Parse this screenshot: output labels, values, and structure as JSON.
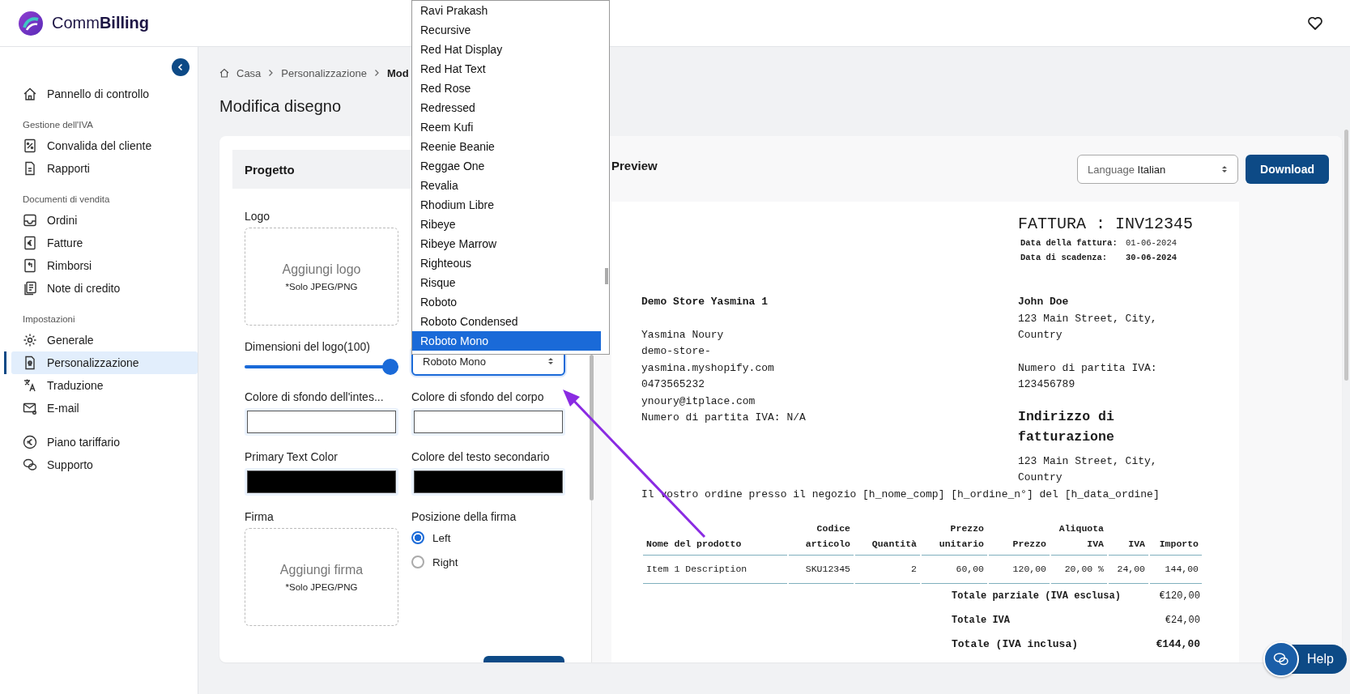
{
  "app": {
    "brand": "Comm**Billing**"
  },
  "sidebar": {
    "sections": [
      {
        "items": [
          {
            "label": "Pannello di controllo",
            "selected": false
          }
        ]
      },
      {
        "title": "Gestione dell'IVA",
        "items": [
          {
            "label": "Convalida del cliente",
            "selected": false
          },
          {
            "label": "Rapporti",
            "selected": false
          }
        ]
      },
      {
        "title": "Documenti di vendita",
        "items": [
          {
            "label": "Ordini",
            "selected": false
          },
          {
            "label": "Fatture",
            "selected": false
          },
          {
            "label": "Rimborsi",
            "selected": false
          },
          {
            "label": "Note di credito",
            "selected": false
          }
        ]
      },
      {
        "title": "Impostazioni",
        "items": [
          {
            "label": "Generale",
            "selected": false
          },
          {
            "label": "Personalizzazione",
            "selected": true
          },
          {
            "label": "Traduzione",
            "selected": false
          },
          {
            "label": "E-mail",
            "selected": false
          }
        ]
      },
      {
        "items": [
          {
            "label": "Piano tariffario",
            "selected": false
          },
          {
            "label": "Supporto",
            "selected": false
          }
        ]
      }
    ]
  },
  "breadcrumb": [
    "Casa",
    "Personalizzazione",
    "Mod"
  ],
  "page_title": "Modifica disegno",
  "design_panel": {
    "title": "Progetto",
    "logo": {
      "label": "Logo",
      "prompt": "Aggiungi logo",
      "note": "*Solo JPEG/PNG"
    },
    "logo_size": {
      "label": "Dimensioni del logo(100)",
      "level": 1
    },
    "font_select": {
      "value": "Roboto Mono"
    },
    "color_fields": [
      {
        "label": "Colore di sfondo dell'intes...",
        "color": "#ffffff"
      },
      {
        "label": "Colore di sfondo del corpo",
        "color": "#ffffff"
      },
      {
        "label": "Primary Text Color",
        "color": "#000000"
      },
      {
        "label": "Colore del testo secondario",
        "color": "#000000"
      }
    ],
    "signature": {
      "label": "Firma",
      "prompt": "Aggiungi firma",
      "note": "*Solo JPEG/PNG"
    },
    "signature_position": {
      "label": "Posizione della firma",
      "options": [
        {
          "label": "Left",
          "selected": true
        },
        {
          "label": "Right",
          "selected": false
        }
      ]
    }
  },
  "font_dropdown": {
    "options": [
      {
        "label": "Ravi Prakash",
        "selected": false
      },
      {
        "label": "Recursive",
        "selected": false
      },
      {
        "label": "Red Hat Display",
        "selected": false
      },
      {
        "label": "Red Hat Text",
        "selected": false
      },
      {
        "label": "Red Rose",
        "selected": false
      },
      {
        "label": "Redressed",
        "selected": false
      },
      {
        "label": "Reem Kufi",
        "selected": false
      },
      {
        "label": "Reenie Beanie",
        "selected": false
      },
      {
        "label": "Reggae One",
        "selected": false
      },
      {
        "label": "Revalia",
        "selected": false
      },
      {
        "label": "Rhodium Libre",
        "selected": false
      },
      {
        "label": "Ribeye",
        "selected": false
      },
      {
        "label": "Ribeye Marrow",
        "selected": false
      },
      {
        "label": "Righteous",
        "selected": false
      },
      {
        "label": "Risque",
        "selected": false
      },
      {
        "label": "Roboto",
        "selected": false
      },
      {
        "label": "Roboto Condensed",
        "selected": false
      },
      {
        "label": "Roboto Mono",
        "selected": true
      }
    ]
  },
  "preview": {
    "title": "Preview",
    "language": {
      "label": "Language",
      "value": "Italian"
    },
    "download_button": "Download",
    "invoice": {
      "title": "FATTURA : INV12345",
      "dates": [
        {
          "label": "Data della fattura:",
          "value": "01-06-2024",
          "emphasis": false
        },
        {
          "label": "Data di scadenza:",
          "value": "30-06-2024",
          "emphasis": true
        }
      ],
      "seller": {
        "name": "Demo Store Yasmina 1",
        "lines": [
          "Yasmina Noury",
          "demo-store-yasmina.myshopify.com",
          "0473565232",
          "ynoury@itplace.com",
          "Numero di partita IVA: N/A"
        ]
      },
      "buyer": {
        "name": "John Doe",
        "address": "123 Main Street, City, Country",
        "vat": "Numero di partita IVA: 123456789"
      },
      "billing": {
        "title": "Indirizzo di fatturazione",
        "address": "123 Main Street, City, Country"
      },
      "note": "Il vostro ordine presso il negozio [h_nome_comp] [h_ordine_n°] del [h_data_ordine]",
      "table": {
        "columns": [
          "Nome del prodotto",
          "Codice articolo",
          "Quantità",
          "Prezzo unitario",
          "Prezzo",
          "Aliquota IVA",
          "IVA",
          "Importo"
        ],
        "rows": [
          [
            "Item 1 Description",
            "SKU12345",
            "2",
            "60,00",
            "120,00",
            "20,00 %",
            "24,00",
            "144,00"
          ]
        ]
      },
      "totals": [
        {
          "label": "Totale parziale (IVA esclusa)",
          "value": "€120,00",
          "grand": false
        },
        {
          "label": "Totale IVA",
          "value": "€24,00",
          "grand": false
        },
        {
          "label": "Totale (IVA inclusa)",
          "value": "€144,00",
          "grand": true
        }
      ]
    }
  },
  "help_button": "Help"
}
